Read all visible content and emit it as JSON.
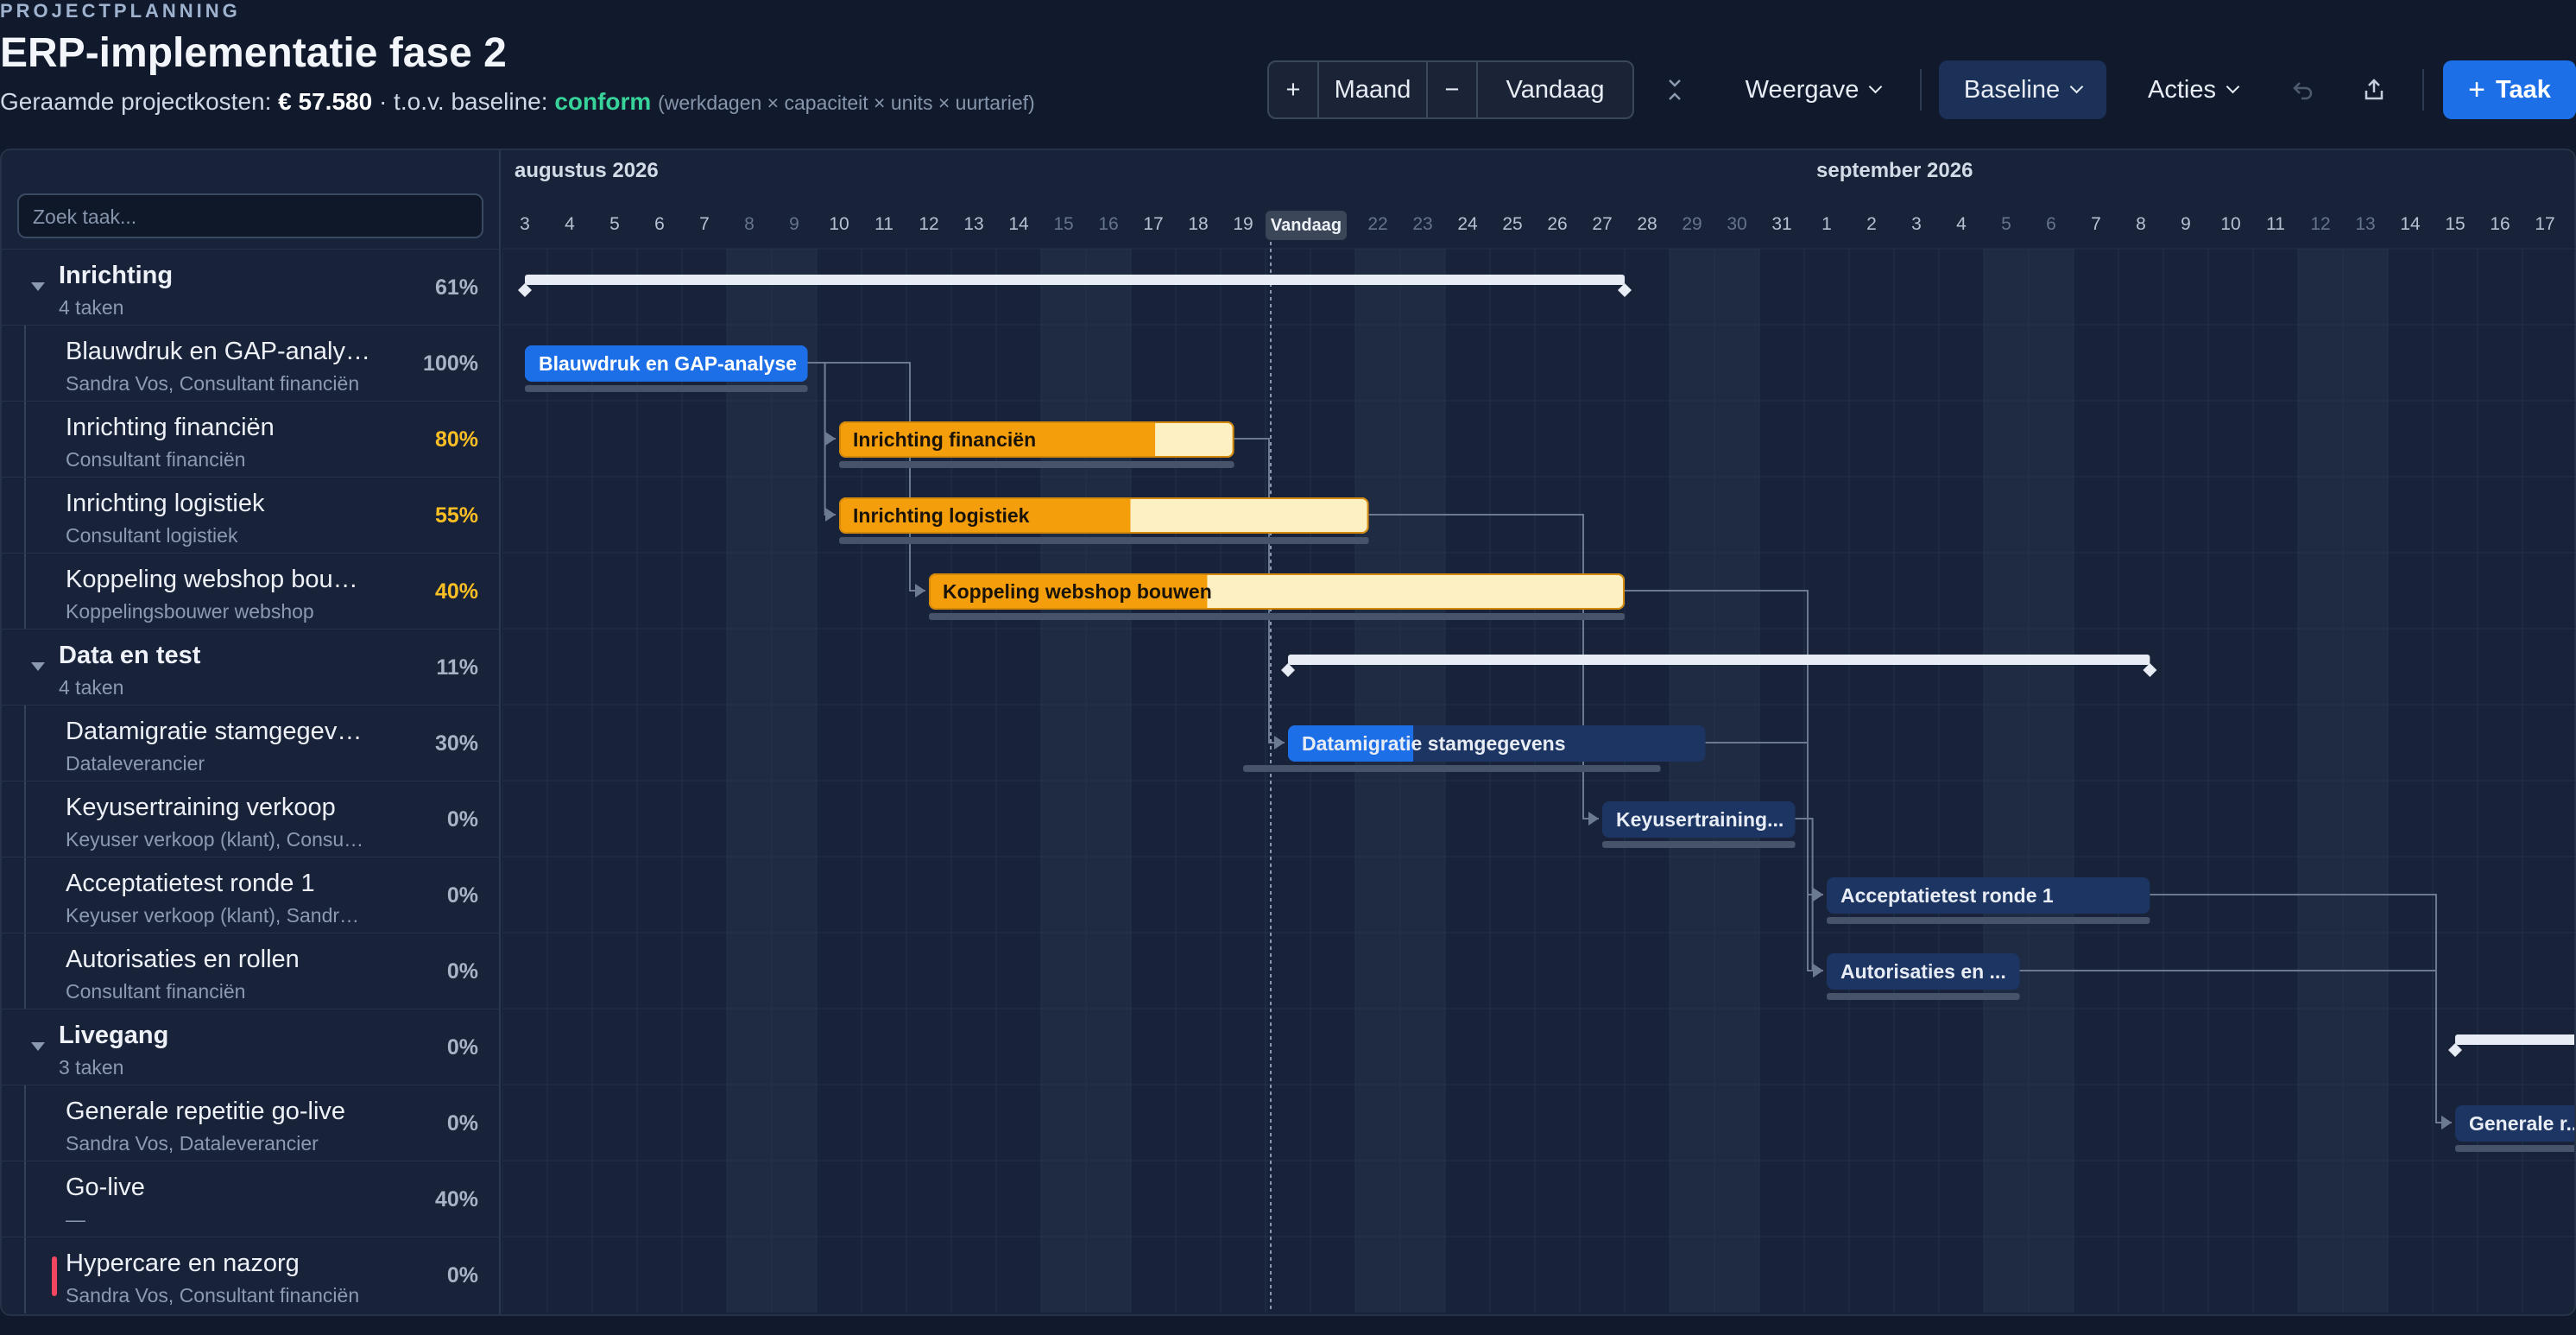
{
  "header": {
    "eyebrow": "PROJECTPLANNING",
    "title": "ERP-implementatie fase 2",
    "cost_prefix": "Geraamde projectkosten:",
    "cost_value": "€ 57.580",
    "baseline_prefix": "· t.o.v. baseline:",
    "baseline_status": "conform",
    "cost_note": "(werkdagen × capaciteit × units × uurtarief)"
  },
  "toolbar": {
    "zoom_in": "+",
    "scale": "Maand",
    "zoom_out": "−",
    "today": "Vandaag",
    "view": "Weergave",
    "baseline": "Baseline",
    "actions": "Acties",
    "add_task": "Taak"
  },
  "search": {
    "placeholder": "Zoek taak..."
  },
  "colors": {
    "blue": "#1d6fe8",
    "amber": "#f59e0b",
    "amber_light": "#fdf0c2",
    "navy": "#1c3563",
    "summary": "#e8edf5"
  },
  "timeline": {
    "months": [
      {
        "label": "augustus 2026",
        "start_index": 0
      },
      {
        "label": "september 2026",
        "start_index": 29
      }
    ],
    "days": [
      "3",
      "4",
      "5",
      "6",
      "7",
      "8",
      "9",
      "10",
      "11",
      "12",
      "13",
      "14",
      "15",
      "16",
      "17",
      "18",
      "19",
      "20",
      "21",
      "22",
      "23",
      "24",
      "25",
      "26",
      "27",
      "28",
      "29",
      "30",
      "31",
      "1",
      "2",
      "3",
      "4",
      "5",
      "6",
      "7",
      "8",
      "9",
      "10",
      "11",
      "12",
      "13",
      "14",
      "15",
      "16",
      "17"
    ],
    "weekend_indices": [
      5,
      6,
      12,
      13,
      19,
      20,
      26,
      27,
      33,
      34,
      40,
      41
    ],
    "today_index": 17,
    "today_label": "Vandaag"
  },
  "rows": [
    {
      "type": "group",
      "name": "Inrichting",
      "sub": "4 taken",
      "pct": "61%",
      "bar": {
        "kind": "summary",
        "start": 0,
        "end": 24.5
      }
    },
    {
      "type": "task",
      "name": "Blauwdruk en GAP-analyse",
      "sub": "Sandra Vos, Consultant financiën",
      "pct": "100%",
      "bar": {
        "kind": "blue",
        "start": 0,
        "end": 6.3,
        "progress": 1,
        "label": "Blauwdruk en GAP-analyse",
        "baseline": [
          0,
          6.3
        ]
      }
    },
    {
      "type": "task",
      "name": "Inrichting financiën",
      "sub": "Consultant financiën",
      "pct": "80%",
      "amber": true,
      "bar": {
        "kind": "amber",
        "start": 7,
        "end": 15.8,
        "progress": 0.8,
        "label": "Inrichting financiën",
        "baseline": [
          7,
          15.8
        ]
      }
    },
    {
      "type": "task",
      "name": "Inrichting logistiek",
      "sub": "Consultant logistiek",
      "pct": "55%",
      "amber": true,
      "bar": {
        "kind": "amber",
        "start": 7,
        "end": 18.8,
        "progress": 0.55,
        "label": "Inrichting logistiek",
        "baseline": [
          7,
          18.8
        ]
      }
    },
    {
      "type": "task",
      "name": "Koppeling webshop bouwen",
      "sub": "Koppelingsbouwer webshop",
      "pct": "40%",
      "amber": true,
      "bar": {
        "kind": "amber",
        "start": 9,
        "end": 24.5,
        "progress": 0.4,
        "label": "Koppeling webshop bouwen",
        "baseline": [
          9,
          24.5
        ]
      }
    },
    {
      "type": "group",
      "name": "Data en test",
      "sub": "4 taken",
      "pct": "11%",
      "bar": {
        "kind": "summary",
        "start": 17,
        "end": 36.2
      }
    },
    {
      "type": "task",
      "name": "Datamigratie stamgegevens",
      "sub": "Dataleverancier",
      "pct": "30%",
      "bar": {
        "kind": "navy",
        "start": 17,
        "end": 26.3,
        "progress": 0.3,
        "label": "Datamigratie stamgegevens",
        "baseline": [
          16,
          25.3
        ]
      }
    },
    {
      "type": "task",
      "name": "Keyusertraining verkoop",
      "sub": "Keyuser verkoop (klant), Consultant financiën",
      "pct": "0%",
      "bar": {
        "kind": "navy",
        "start": 24,
        "end": 28.3,
        "progress": 0,
        "label": "Keyusertraining...",
        "baseline": [
          24,
          28.3
        ]
      }
    },
    {
      "type": "task",
      "name": "Acceptatietest ronde 1",
      "sub": "Keyuser verkoop (klant), Sandra Vos",
      "pct": "0%",
      "bar": {
        "kind": "navy",
        "start": 29,
        "end": 36.2,
        "progress": 0,
        "label": "Acceptatietest ronde 1",
        "baseline": [
          29,
          36.2
        ]
      }
    },
    {
      "type": "task",
      "name": "Autorisaties en rollen",
      "sub": "Consultant financiën",
      "pct": "0%",
      "bar": {
        "kind": "navy",
        "start": 29,
        "end": 33.3,
        "progress": 0,
        "label": "Autorisaties en ...",
        "baseline": [
          29,
          33.3
        ]
      }
    },
    {
      "type": "group",
      "name": "Livegang",
      "sub": "3 taken",
      "pct": "0%",
      "bar": {
        "kind": "summary",
        "start": 43,
        "end": 47
      }
    },
    {
      "type": "task",
      "name": "Generale repetitie go-live",
      "sub": "Sandra Vos, Dataleverancier",
      "pct": "0%",
      "bar": {
        "kind": "navy",
        "start": 43,
        "end": 47,
        "progress": 0,
        "label": "Generale r...",
        "baseline": [
          43,
          47
        ]
      }
    },
    {
      "type": "task",
      "name": "Go-live",
      "sub": "—",
      "pct": "40%"
    },
    {
      "type": "task",
      "name": "Hypercare en nazorg",
      "sub": "Sandra Vos, Consultant financiën",
      "pct": "0%",
      "redmark": true
    }
  ],
  "dependencies": [
    {
      "from": 1,
      "to": 2
    },
    {
      "from": 1,
      "to": 3
    },
    {
      "from": 1,
      "to": 4
    },
    {
      "from": 2,
      "to": 6
    },
    {
      "from": 3,
      "to": 7
    },
    {
      "from": 4,
      "to": 8
    },
    {
      "from": 4,
      "to": 9
    },
    {
      "from": 6,
      "to": 8
    },
    {
      "from": 7,
      "to": 9
    },
    {
      "from": 8,
      "to": 11
    },
    {
      "from": 9,
      "to": 11
    }
  ]
}
